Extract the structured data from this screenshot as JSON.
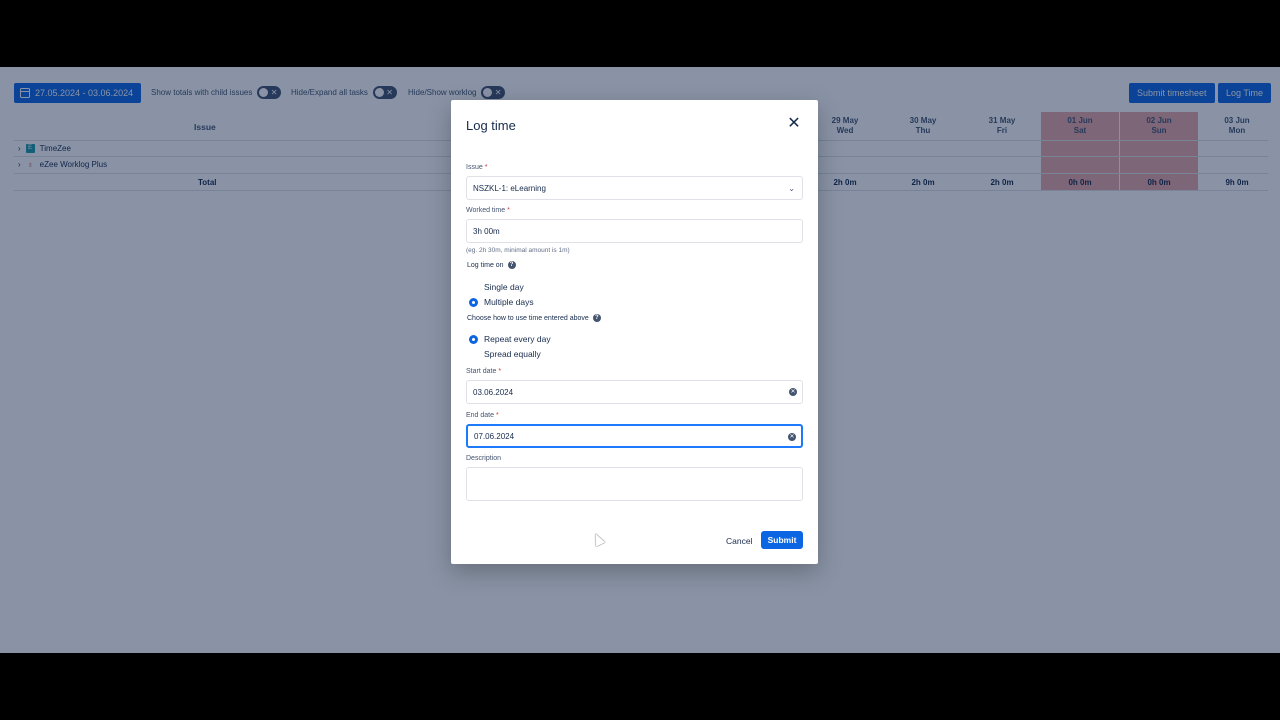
{
  "toolbar": {
    "date_range": "27.05.2024 - 03.06.2024",
    "toggle_child_issues": "Show totals with child issues",
    "toggle_expand_tasks": "Hide/Expand all tasks",
    "toggle_worklog": "Hide/Show worklog",
    "submit_timesheet": "Submit timesheet",
    "log_time": "Log Time"
  },
  "table": {
    "issue_header": "Issue",
    "days": [
      {
        "date": "29 May",
        "dow": "Wed",
        "weekend": false,
        "total": "2h 0m"
      },
      {
        "date": "30 May",
        "dow": "Thu",
        "weekend": false,
        "total": "2h 0m"
      },
      {
        "date": "31 May",
        "dow": "Fri",
        "weekend": false,
        "total": "2h 0m"
      },
      {
        "date": "01 Jun",
        "dow": "Sat",
        "weekend": true,
        "total": "0h 0m"
      },
      {
        "date": "02 Jun",
        "dow": "Sun",
        "weekend": true,
        "total": "0h 0m"
      },
      {
        "date": "03 Jun",
        "dow": "Mon",
        "weekend": false,
        "total": "9h 0m"
      }
    ],
    "rows": [
      {
        "label": "TimeZee"
      },
      {
        "label": "eZee Worklog Plus"
      }
    ],
    "total_label": "Total"
  },
  "modal": {
    "title": "Log time",
    "issue_label": "Issue",
    "issue_value": "NSZKL-1: eLearning",
    "worked_label": "Worked time",
    "worked_value": "3h 00m",
    "worked_hint": "(eg. 2h 30m, minimal amount is 1m)",
    "log_on_label": "Log time on",
    "opt_single": "Single day",
    "opt_multiple": "Multiple days",
    "how_label": "Choose how to use time entered above",
    "opt_repeat": "Repeat every day",
    "opt_spread": "Spread equally",
    "start_label": "Start date",
    "start_value": "03.06.2024",
    "end_label": "End date",
    "end_value": "07.06.2024",
    "desc_label": "Description",
    "cancel": "Cancel",
    "submit": "Submit",
    "required_mark": "*"
  }
}
